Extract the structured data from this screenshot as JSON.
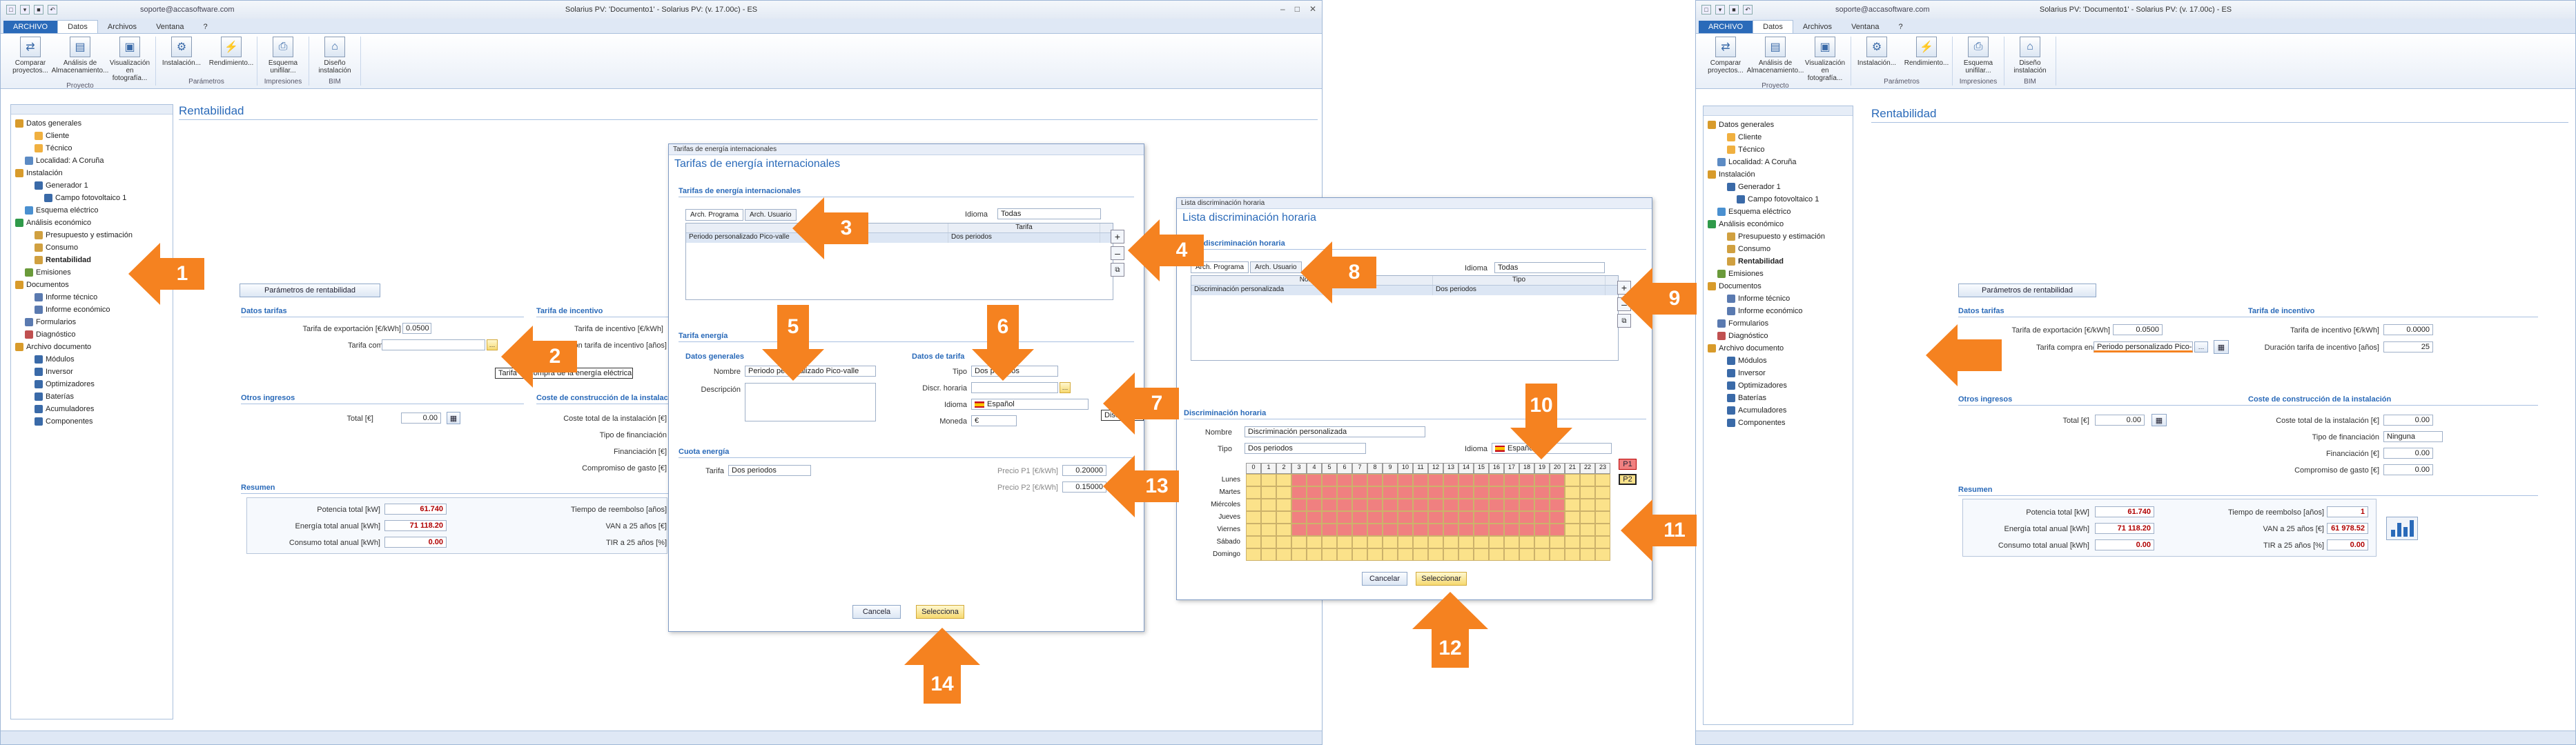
{
  "app": {
    "email": "soporte@accasoftware.com",
    "title": "Solarius PV: 'Documento1' - Solarius PV: (v. 17.00c) - ES",
    "menu_tabs": [
      "ARCHIVO",
      "Datos",
      "Archivos",
      "Ventana",
      "?"
    ],
    "ribbon_groups": [
      {
        "label": "Proyecto",
        "buttons": [
          "Comparar proyectos...",
          "Análisis de Almacenamiento...",
          "Visualización en fotografía..."
        ]
      },
      {
        "label": "Parámetros",
        "buttons": [
          "Instalación...",
          "Rendimiento..."
        ]
      },
      {
        "label": "Impresiones",
        "buttons": [
          "Esquema unifilar..."
        ]
      },
      {
        "label": "BIM",
        "buttons": [
          "Diseño instalación"
        ]
      }
    ]
  },
  "tree": [
    {
      "label": "Datos generales",
      "level": 0,
      "color": "#d89b2b"
    },
    {
      "label": "Cliente",
      "level": 2,
      "color": "#f0b040"
    },
    {
      "label": "Técnico",
      "level": 2,
      "color": "#f0b040"
    },
    {
      "label": "Localidad: A Coruña",
      "level": 1,
      "color": "#5c8bc4"
    },
    {
      "label": "Instalación",
      "level": 0,
      "color": "#d89b2b"
    },
    {
      "label": "Generador 1",
      "level": 2,
      "color": "#3a6aa8"
    },
    {
      "label": "Campo fotovoltaico 1",
      "level": 3,
      "color": "#3a6aa8"
    },
    {
      "label": "Esquema eléctrico",
      "level": 1,
      "color": "#4a90d0"
    },
    {
      "label": "Análisis económico",
      "level": 0,
      "color": "#2f9a4a"
    },
    {
      "label": "Presupuesto y estimación",
      "level": 2,
      "color": "#d0a040"
    },
    {
      "label": "Consumo",
      "level": 2,
      "color": "#d0a040"
    },
    {
      "label": "Rentabilidad",
      "level": 2,
      "color": "#d0a040",
      "bold": true
    },
    {
      "label": "Emisiones",
      "level": 1,
      "color": "#6a9a3a"
    },
    {
      "label": "Documentos",
      "level": 0,
      "color": "#d89b2b"
    },
    {
      "label": "Informe técnico",
      "level": 2,
      "color": "#5a7ab0"
    },
    {
      "label": "Informe económico",
      "level": 2,
      "color": "#5a7ab0"
    },
    {
      "label": "Formularios",
      "level": 1,
      "color": "#5a7ab0"
    },
    {
      "label": "Diagnóstico",
      "level": 1,
      "color": "#c05050"
    },
    {
      "label": "Archivo documento",
      "level": 0,
      "color": "#d89b2b"
    },
    {
      "label": "Módulos",
      "level": 2,
      "color": "#3a6aa8"
    },
    {
      "label": "Inversor",
      "level": 2,
      "color": "#3a6aa8"
    },
    {
      "label": "Optimizadores",
      "level": 2,
      "color": "#3a6aa8"
    },
    {
      "label": "Baterías",
      "level": 2,
      "color": "#3a6aa8"
    },
    {
      "label": "Acumuladores",
      "level": 2,
      "color": "#3a6aa8"
    },
    {
      "label": "Componentes",
      "level": 2,
      "color": "#3a6aa8"
    }
  ],
  "rentabilidad": {
    "title": "Rentabilidad",
    "params_button": "Parámetros de rentabilidad",
    "datos_tarifas": "Datos tarifas",
    "tarifa_export_label": "Tarifa de exportación [€/kWh]",
    "tarifa_export_left": "0.0500",
    "tarifa_export_right": "0.0500",
    "tarifa_compra_label": "Tarifa compra energía",
    "tarifa_compra_value_right": "Periodo personalizado Pico-...",
    "tooltip": "Tarifa de compra de la energía eléctrica",
    "tarifa_incentivo_hdr": "Tarifa de incentivo",
    "tarifa_incentivo_label": "Tarifa de incentivo [€/kWh]",
    "tarifa_incentivo_value": "0.0000",
    "duracion_label": "Duración tarifa de incentivo [años]",
    "duracion_value": "25",
    "otros_ingresos": "Otros ingresos",
    "total_label": "Total [€]",
    "total_value": "0.00",
    "coste_hdr": "Coste de construcción de la instalación",
    "coste_label": "Coste total de la instalación [€]",
    "coste_value": "0.00",
    "tipo_fin_label": "Tipo de financiación",
    "tipo_fin_value": "Ninguna",
    "financiacion_label": "Financiación [€]",
    "financiacion_value": "0.00",
    "compromiso_label": "Compromiso de gasto [€]",
    "compromiso_value": "0.00",
    "resumen": "Resumen",
    "potencia_label": "Potencia total [kW]",
    "potencia_value": "61.740",
    "energia_label": "Energía total anual [kWh]",
    "energia_value": "71 118.20",
    "consumo_label": "Consumo total anual [kWh]",
    "consumo_value": "0.00",
    "reembolso_label": "Tiempo de reembolso [años]",
    "reembolso_value": "1",
    "van_label": "VAN a 25 años [€]",
    "van_value": "61 978.52",
    "tir_label": "TIR a 25 años [%]",
    "tir_value": "0.00"
  },
  "dlg_tarifas": {
    "window_title": "Tarifas de energía internacionales",
    "heading": "Tarifas de energía internacionales",
    "section": "Tarifas de energía internacionales",
    "tab1": "Arch. Programa",
    "tab2": "Arch. Usuario",
    "idioma_label": "Idioma",
    "idioma_value": "Todas",
    "col_nombre": "Nombre",
    "col_tarifa": "Tarifa",
    "row_nombre": "Periodo personalizado Pico-valle",
    "row_tarifa": "Dos periodos",
    "tarifa_energia": "Tarifa energía",
    "datos_generales": "Datos generales",
    "nombre_label": "Nombre",
    "nombre_value": "Periodo personalizado Pico-valle",
    "descripcion_label": "Descripción",
    "datos_tarifa": "Datos de tarifa",
    "tipo_label": "Tipo",
    "tipo_value": "Dos periodos",
    "discr_label": "Discr. horaria",
    "idioma2_label": "Idioma",
    "idioma2_value": "Español",
    "moneda_label": "Moneda",
    "moneda_value": "€",
    "cuota_energia": "Cuota energía",
    "tarifa_label": "Tarifa",
    "tarifa_value": "Dos periodos",
    "precio1_label": "Precio P1 [€/kWh]",
    "precio1_value": "0.20000",
    "precio2_label": "Precio P2 [€/kWh]",
    "precio2_value": "0.15000",
    "discr_tip": "Discrimin...",
    "cancel": "Cancela",
    "select": "Selecciona"
  },
  "dlg_discr": {
    "window_title": "Lista discriminación horaria",
    "heading": "Lista discriminación horaria",
    "section": "Lista discriminación horaria",
    "tab1": "Arch. Programa",
    "tab2": "Arch. Usuario",
    "idioma_label": "Idioma",
    "idioma_value": "Todas",
    "col_nombre": "Nombre",
    "col_tipo": "Tipo",
    "row_nombre": "Discriminación personalizada",
    "row_tipo": "Dos periodos",
    "discr_section": "Discriminación horaria",
    "nombre_label": "Nombre",
    "nombre_value": "Discriminación personalizada",
    "tipo_label": "Tipo",
    "tipo_value": "Dos periodos",
    "idioma2_label": "Idioma",
    "idioma2_value": "Español",
    "hours": [
      "0",
      "1",
      "2",
      "3",
      "4",
      "5",
      "6",
      "7",
      "8",
      "9",
      "10",
      "11",
      "12",
      "13",
      "14",
      "15",
      "16",
      "17",
      "18",
      "19",
      "20",
      "21",
      "22",
      "23"
    ],
    "days": [
      "Lunes",
      "Martes",
      "Miércoles",
      "Jueves",
      "Viernes",
      "Sábado",
      "Domingo"
    ],
    "p1": "P1",
    "p2": "P2",
    "cancel": "Cancelar",
    "select": "Seleccionar"
  },
  "markers": [
    "1",
    "2",
    "3",
    "4",
    "5",
    "6",
    "7",
    "8",
    "9",
    "10",
    "11",
    "12",
    "13",
    "14"
  ],
  "colors": {
    "accent": "#2a6ab9",
    "arrow": "#f58220",
    "p1": "#f08080",
    "p2": "#fbe28a"
  }
}
